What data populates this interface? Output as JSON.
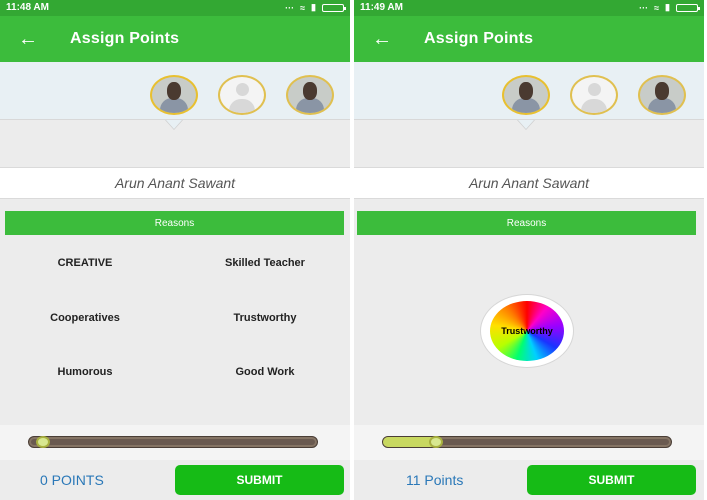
{
  "colors": {
    "status_bar": "#33a833",
    "app_bar": "#3cbc3c",
    "submit": "#16bb16",
    "points_text": "#2a78b8"
  },
  "left": {
    "status": {
      "time": "11:48 AM",
      "icons": "··· ≈ ▮"
    },
    "header": {
      "title": "Assign Points",
      "back_icon": "arrow-left-icon"
    },
    "selected_name": "Arun Anant Sawant",
    "reasons_title": "Reasons",
    "reasons": [
      {
        "label": "CREATIVE"
      },
      {
        "label": "Skilled Teacher"
      },
      {
        "label": "Cooperatives"
      },
      {
        "label": "Trustworthy"
      },
      {
        "label": "Humorous"
      },
      {
        "label": "Good Work"
      }
    ],
    "slider": {
      "fraction": 0.0
    },
    "points_label": "0 POINTS",
    "submit_label": "SUBMIT"
  },
  "right": {
    "status": {
      "time": "11:49 AM",
      "icons": "··· ≈ ▮"
    },
    "header": {
      "title": "Assign Points",
      "back_icon": "arrow-left-icon"
    },
    "selected_name": "Arun Anant Sawant",
    "reasons_title": "Reasons",
    "selected_reason": "Trustworthy",
    "slider": {
      "fraction": 0.15
    },
    "points_label": "11 Points",
    "submit_label": "SUBMIT"
  }
}
